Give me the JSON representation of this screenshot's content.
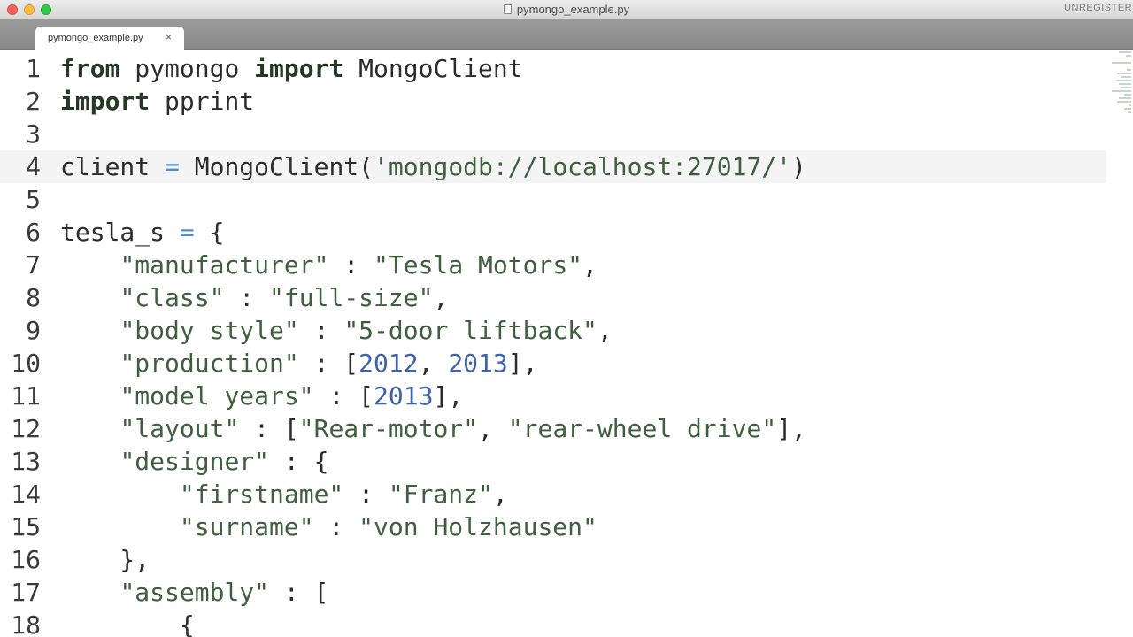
{
  "window": {
    "title": "pymongo_example.py",
    "unregistered": "UNREGISTERED"
  },
  "tabs": [
    {
      "label": "pymongo_example.py",
      "close": "×"
    }
  ],
  "editor": {
    "current_line": 4,
    "lines": [
      {
        "n": "1",
        "tokens": [
          {
            "t": "kw",
            "v": "from"
          },
          {
            "t": "plain",
            "v": " pymongo "
          },
          {
            "t": "kw",
            "v": "import"
          },
          {
            "t": "plain",
            "v": " MongoClient"
          }
        ]
      },
      {
        "n": "2",
        "tokens": [
          {
            "t": "kw",
            "v": "import"
          },
          {
            "t": "plain",
            "v": " pprint"
          }
        ]
      },
      {
        "n": "3",
        "tokens": []
      },
      {
        "n": "4",
        "tokens": [
          {
            "t": "plain",
            "v": "client "
          },
          {
            "t": "op",
            "v": "="
          },
          {
            "t": "plain",
            "v": " MongoClient("
          },
          {
            "t": "str",
            "v": "'mongodb://localhost:27017/'"
          },
          {
            "t": "plain",
            "v": ")"
          }
        ]
      },
      {
        "n": "5",
        "tokens": []
      },
      {
        "n": "6",
        "tokens": [
          {
            "t": "plain",
            "v": "tesla_s "
          },
          {
            "t": "op",
            "v": "="
          },
          {
            "t": "plain",
            "v": " {"
          }
        ]
      },
      {
        "n": "7",
        "tokens": [
          {
            "t": "plain",
            "v": "    "
          },
          {
            "t": "str",
            "v": "\"manufacturer\""
          },
          {
            "t": "plain",
            "v": " : "
          },
          {
            "t": "str",
            "v": "\"Tesla Motors\""
          },
          {
            "t": "plain",
            "v": ","
          }
        ]
      },
      {
        "n": "8",
        "tokens": [
          {
            "t": "plain",
            "v": "    "
          },
          {
            "t": "str",
            "v": "\"class\""
          },
          {
            "t": "plain",
            "v": " : "
          },
          {
            "t": "str",
            "v": "\"full-size\""
          },
          {
            "t": "plain",
            "v": ","
          }
        ]
      },
      {
        "n": "9",
        "tokens": [
          {
            "t": "plain",
            "v": "    "
          },
          {
            "t": "str",
            "v": "\"body style\""
          },
          {
            "t": "plain",
            "v": " : "
          },
          {
            "t": "str",
            "v": "\"5-door liftback\""
          },
          {
            "t": "plain",
            "v": ","
          }
        ]
      },
      {
        "n": "10",
        "tokens": [
          {
            "t": "plain",
            "v": "    "
          },
          {
            "t": "str",
            "v": "\"production\""
          },
          {
            "t": "plain",
            "v": " : ["
          },
          {
            "t": "num",
            "v": "2012"
          },
          {
            "t": "plain",
            "v": ", "
          },
          {
            "t": "num",
            "v": "2013"
          },
          {
            "t": "plain",
            "v": "],"
          }
        ]
      },
      {
        "n": "11",
        "tokens": [
          {
            "t": "plain",
            "v": "    "
          },
          {
            "t": "str",
            "v": "\"model years\""
          },
          {
            "t": "plain",
            "v": " : ["
          },
          {
            "t": "num",
            "v": "2013"
          },
          {
            "t": "plain",
            "v": "],"
          }
        ]
      },
      {
        "n": "12",
        "tokens": [
          {
            "t": "plain",
            "v": "    "
          },
          {
            "t": "str",
            "v": "\"layout\""
          },
          {
            "t": "plain",
            "v": " : ["
          },
          {
            "t": "str",
            "v": "\"Rear-motor\""
          },
          {
            "t": "plain",
            "v": ", "
          },
          {
            "t": "str",
            "v": "\"rear-wheel drive\""
          },
          {
            "t": "plain",
            "v": "],"
          }
        ]
      },
      {
        "n": "13",
        "tokens": [
          {
            "t": "plain",
            "v": "    "
          },
          {
            "t": "str",
            "v": "\"designer\""
          },
          {
            "t": "plain",
            "v": " : {"
          }
        ]
      },
      {
        "n": "14",
        "tokens": [
          {
            "t": "plain",
            "v": "        "
          },
          {
            "t": "str",
            "v": "\"firstname\""
          },
          {
            "t": "plain",
            "v": " : "
          },
          {
            "t": "str",
            "v": "\"Franz\""
          },
          {
            "t": "plain",
            "v": ","
          }
        ]
      },
      {
        "n": "15",
        "tokens": [
          {
            "t": "plain",
            "v": "        "
          },
          {
            "t": "str",
            "v": "\"surname\""
          },
          {
            "t": "plain",
            "v": " : "
          },
          {
            "t": "str",
            "v": "\"von Holzhausen\""
          }
        ]
      },
      {
        "n": "16",
        "tokens": [
          {
            "t": "plain",
            "v": "    },"
          }
        ]
      },
      {
        "n": "17",
        "tokens": [
          {
            "t": "plain",
            "v": "    "
          },
          {
            "t": "str",
            "v": "\"assembly\""
          },
          {
            "t": "plain",
            "v": " : ["
          }
        ]
      },
      {
        "n": "18",
        "tokens": [
          {
            "t": "plain",
            "v": "        {"
          }
        ]
      }
    ]
  },
  "colors": {
    "keyword": "#243a25",
    "string": "#3f5f3f",
    "number": "#3d64a6",
    "operator": "#4a8ed6",
    "current_line_bg": "#f4f4f4"
  }
}
